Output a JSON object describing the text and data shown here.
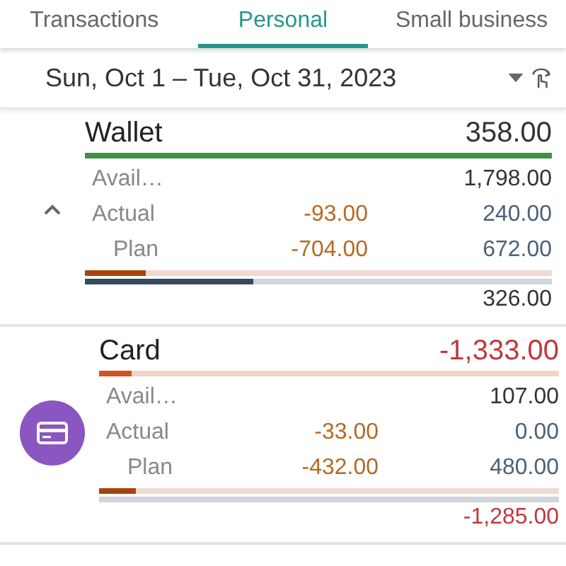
{
  "tabs": [
    {
      "label": "Transactions",
      "selected": false
    },
    {
      "label": "Personal",
      "selected": true
    },
    {
      "label": "Small business",
      "selected": false
    }
  ],
  "period": {
    "label": "Sun, Oct 1 – Tue, Oct 31, 2023"
  },
  "accounts": [
    {
      "name": "Wallet",
      "kind": "chevron",
      "expanded": true,
      "negative": false,
      "balance": "358.00",
      "balance_bar": {
        "level": 1,
        "color": "#3f9142"
      },
      "available_label": "Avail…",
      "available": "1,798.00",
      "actual_label": "Actual",
      "actual_expense": "-93.00",
      "actual_income": "240.00",
      "plan_label": "Plan",
      "plan_expense": "-704.00",
      "plan_income": "672.00",
      "expense_bar": {
        "level": 0.13
      },
      "income_bar": {
        "level": 0.36
      },
      "total": "326.00"
    },
    {
      "name": "Card",
      "kind": "icon",
      "negative": true,
      "balance": "-1,333.00",
      "balance_bar": {
        "level": 0.07,
        "color": "#d4521f"
      },
      "available_label": "Avail…",
      "available": "107.00",
      "actual_label": "Actual",
      "actual_expense": "-33.00",
      "actual_income": "0.00",
      "plan_label": "Plan",
      "plan_expense": "-432.00",
      "plan_income": "480.00",
      "expense_bar": {
        "level": 0.08
      },
      "income_bar": {
        "level": 0
      },
      "total": "-1,285.00"
    }
  ]
}
